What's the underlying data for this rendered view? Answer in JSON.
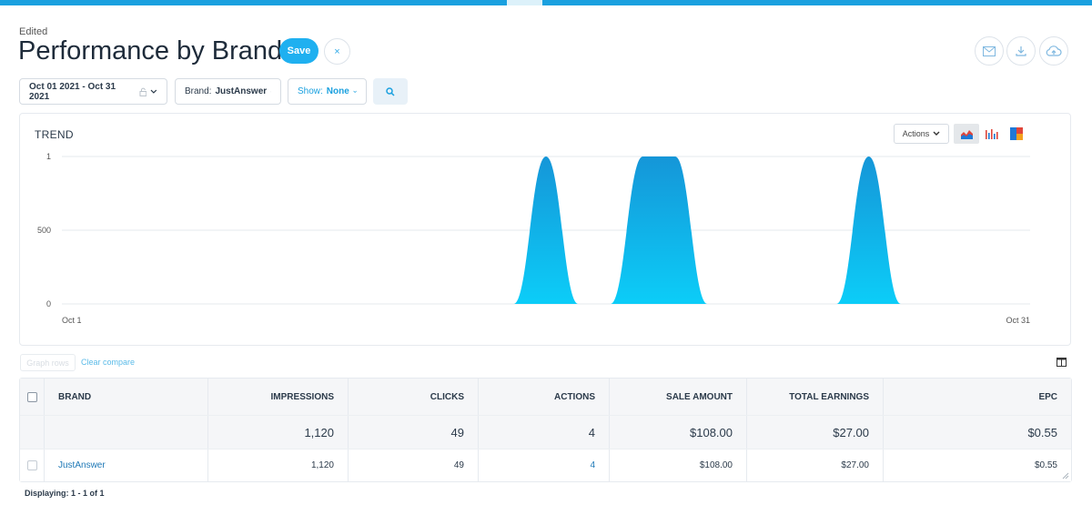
{
  "header": {
    "status": "Edited",
    "title": "Performance by Brand",
    "save_label": "Save",
    "close_glyph": "×"
  },
  "toolbar_icons": [
    "email-icon",
    "download-icon",
    "cloud-upload-icon"
  ],
  "filters": {
    "date_range": "Oct 01 2021 - Oct 31 2021",
    "brand_prefix": "Brand:",
    "brand_value": "JustAnswer",
    "show_prefix": "Show:",
    "show_value": "None"
  },
  "trend": {
    "title": "TREND",
    "actions_label": "Actions",
    "chart_types": [
      "area-chart-icon",
      "bar-chart-icon",
      "heatmap-icon"
    ]
  },
  "chart_data": {
    "type": "area",
    "title": "TREND",
    "x_start_label": "Oct 1",
    "x_end_label": "Oct 31",
    "y_ticks": [
      "1",
      "500",
      "0"
    ],
    "ylim": [
      0,
      1000
    ],
    "series": [
      {
        "values": [
          [
            "2021-10-01",
            0
          ],
          [
            "2021-10-15",
            0
          ],
          [
            "2021-10-16",
            1000
          ],
          [
            "2021-10-17",
            0
          ],
          [
            "2021-10-18",
            0
          ],
          [
            "2021-10-19",
            1000
          ],
          [
            "2021-10-20",
            1000
          ],
          [
            "2021-10-21",
            0
          ],
          [
            "2021-10-25",
            0
          ],
          [
            "2021-10-26",
            1000
          ],
          [
            "2021-10-27",
            0
          ],
          [
            "2021-10-31",
            0
          ]
        ]
      }
    ],
    "colors": {
      "top": "#1596d8",
      "bottom": "#0ccdf8"
    },
    "grid": true
  },
  "compare": {
    "graph_label": "Graph rows",
    "clear_label": "Clear compare"
  },
  "table": {
    "columns": [
      "BRAND",
      "IMPRESSIONS",
      "CLICKS",
      "ACTIONS",
      "SALE AMOUNT",
      "TOTAL EARNINGS",
      "EPC"
    ],
    "totals": [
      "",
      "1,120",
      "49",
      "4",
      "$108.00",
      "$27.00",
      "$0.55"
    ],
    "rows": [
      [
        "JustAnswer",
        "1,120",
        "49",
        "4",
        "$108.00",
        "$27.00",
        "$0.55"
      ]
    ]
  },
  "footer": {
    "displaying": "Displaying: 1 - 1 of 1"
  }
}
